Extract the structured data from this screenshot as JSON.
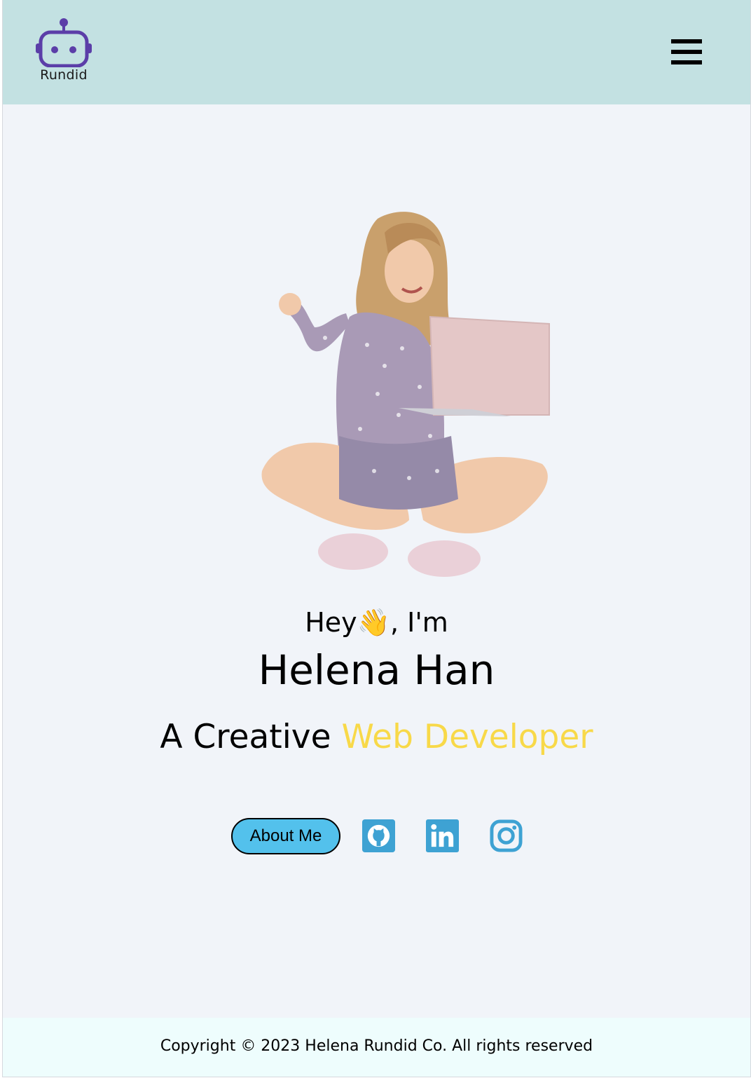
{
  "header": {
    "logo_text": "Rundid",
    "menu_icon": "hamburger-menu-icon",
    "background": "#c3e1e2",
    "logo_color": "#5b3ea8"
  },
  "hero": {
    "greeting_prefix": "Hey",
    "greeting_emoji": "👋",
    "greeting_suffix": ", I'm",
    "name": "Helena Han",
    "role_prefix": "A Creative ",
    "role_highlight": "Web Developer",
    "highlight_color": "#f8d949",
    "image_alt": "woman sitting cross-legged holding a laptop"
  },
  "actions": {
    "about_label": "About Me",
    "about_color": "#53c1ec",
    "icon_color": "#3ea2d3",
    "social": [
      {
        "name": "github-icon"
      },
      {
        "name": "linkedin-icon"
      },
      {
        "name": "instagram-icon"
      }
    ]
  },
  "footer": {
    "copyright": "Copyright © 2023 Helena Rundid Co. All rights reserved",
    "background": "#eefdfd"
  }
}
